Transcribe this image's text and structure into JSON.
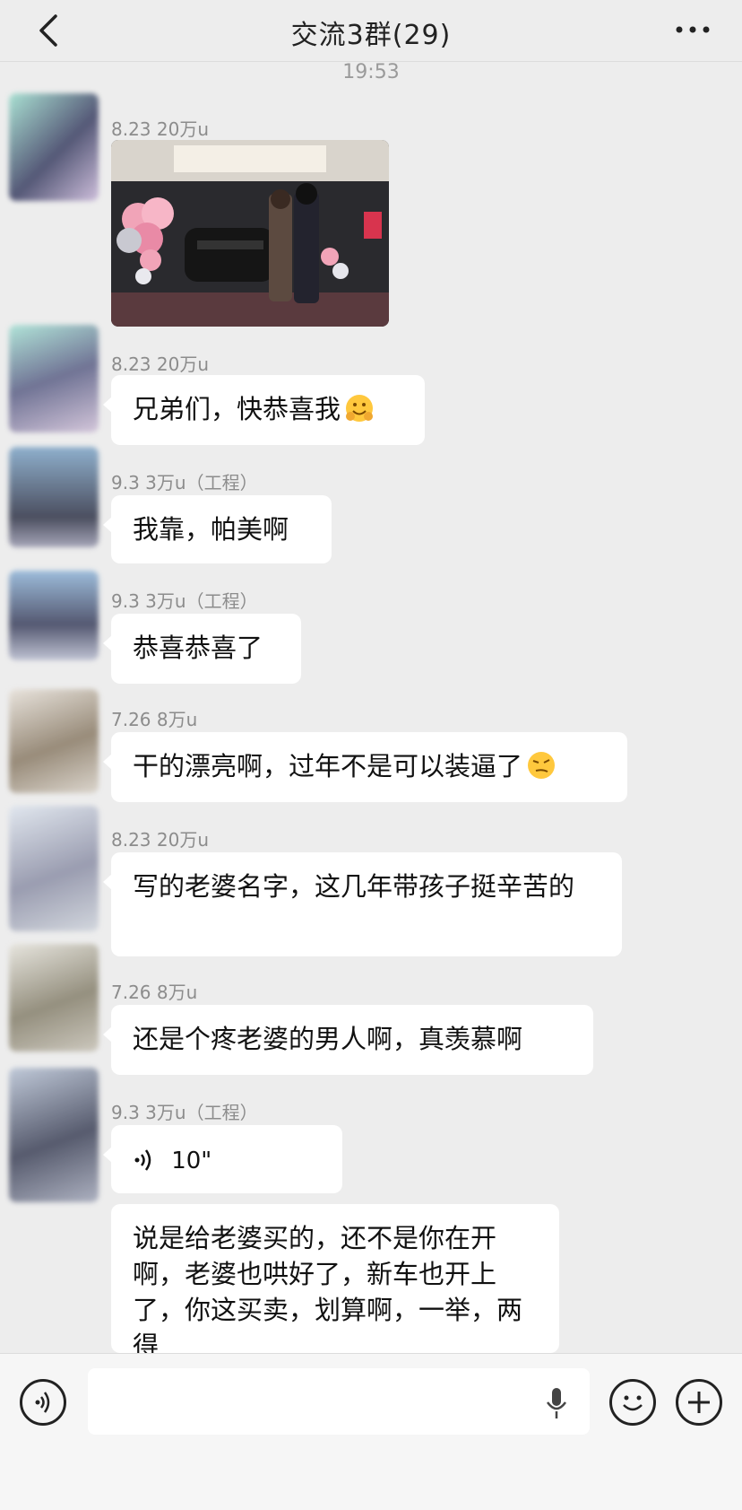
{
  "header": {
    "title": "交流3群(29)"
  },
  "timestamp": "19:53",
  "messages": [
    {
      "sender": "8.23 20万u",
      "type": "image"
    },
    {
      "sender": "8.23 20万u",
      "text": "兄弟们，快恭喜我",
      "emoji": "hugging-face"
    },
    {
      "sender": "9.3 3万u（工程）",
      "text": "我靠，帕美啊"
    },
    {
      "sender": "9.3 3万u（工程）",
      "text": "恭喜恭喜了"
    },
    {
      "sender": "7.26 8万u",
      "text": "干的漂亮啊，过年不是可以装逼了",
      "emoji": "smirk-face"
    },
    {
      "sender": "8.23 20万u",
      "text": "写的老婆名字，这几年带孩子挺辛苦的"
    },
    {
      "sender": "7.26 8万u",
      "text": "还是个疼老婆的男人啊，真羡慕啊"
    },
    {
      "sender": "9.3 3万u（工程）",
      "voice_duration": "10\""
    },
    {
      "text": "说是给老婆买的，还不是你在开啊，老婆也哄好了，新车也开上了，你这买卖，划算啊，一举，两得"
    }
  ],
  "icons": [
    "back-arrow-icon",
    "more-dots-icon",
    "voice-input-icon",
    "mic-icon",
    "emoji-icon",
    "plus-icon"
  ]
}
